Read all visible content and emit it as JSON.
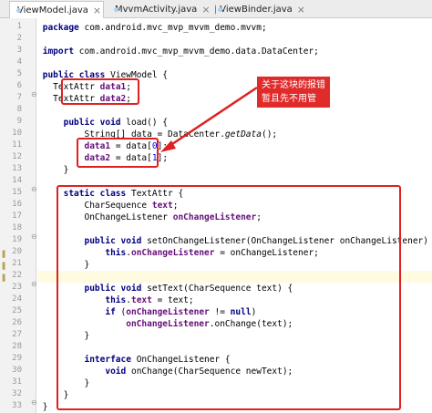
{
  "tabs": [
    {
      "label": "ViewModel.java",
      "close": "×",
      "active": true
    },
    {
      "label": "MvvmActivity.java",
      "close": "×",
      "active": false
    },
    {
      "label": "ViewBinder.java",
      "close": "×",
      "active": false
    }
  ],
  "line_numbers": [
    "1",
    "2",
    "3",
    "4",
    "5",
    "6",
    "7",
    "8",
    "9",
    "10",
    "11",
    "12",
    "13",
    "14",
    "15",
    "16",
    "17",
    "18",
    "19",
    "20",
    "21",
    "22",
    "23",
    "24",
    "25",
    "26",
    "27",
    "28",
    "29",
    "30",
    "31",
    "32",
    "33"
  ],
  "callout": {
    "text": "关于这块的报错暂且先不用管"
  },
  "code": {
    "l1": {
      "kw": "package",
      "rest": " com.android.mvc_mvp_mvvm_demo.mvvm;"
    },
    "l3": {
      "kw": "import",
      "rest": " com.android.mvc_mvp_mvvm_demo.data.DataCenter;"
    },
    "l5": {
      "kw": "public class",
      "rest": " ViewModel {"
    },
    "l6": {
      "type": "TextAttr ",
      "field": "data1",
      "end": ";"
    },
    "l7": {
      "type": "TextAttr ",
      "field": "data2",
      "end": ";"
    },
    "l9": {
      "kw": "public void",
      "rest": " load() {"
    },
    "l10": {
      "pre": "String[] data = DataCenter.",
      "method": "getData",
      "post": "();"
    },
    "l11": {
      "field": "data1",
      "pre": " = data[",
      "num": "0",
      "post": "];"
    },
    "l12": {
      "field": "data2",
      "pre": " = data[",
      "num": "1",
      "post": "];"
    },
    "l13": {
      "text": "}"
    },
    "l15": {
      "kw": "static class",
      "rest": " TextAttr {"
    },
    "l16": {
      "pre": "CharSequence ",
      "field": "text",
      "post": ";"
    },
    "l17": {
      "pre": "OnChangeListener ",
      "field": "onChangeListener",
      "post": ";"
    },
    "l19": {
      "kw": "public void",
      "rest": " setOnChangeListener(OnChangeListener onChangeListener) {"
    },
    "l20": {
      "kw": "this",
      "dot": ".",
      "field": "onChangeListener",
      "post": " = onChangeListener;"
    },
    "l21": {
      "text": "}"
    },
    "l23": {
      "kw": "public void",
      "rest": " setText(CharSequence text) {"
    },
    "l24": {
      "kw": "this",
      "dot": ".",
      "field": "text",
      "post": " = text;"
    },
    "l25": {
      "kw": "if",
      "pre": " (",
      "field": "onChangeListener",
      "kw2": "null",
      "mid": " != ",
      "post": ")"
    },
    "l26": {
      "field": "onChangeListener",
      "post": ".onChange(text);"
    },
    "l27": {
      "text": "}"
    },
    "l29": {
      "kw": "interface",
      "rest": " OnChangeListener {"
    },
    "l30": {
      "kw": "void",
      "rest": " onChange(CharSequence newText);"
    },
    "l31": {
      "text": "}"
    },
    "l32": {
      "text": "}"
    },
    "l33": {
      "text": "}"
    }
  },
  "colors": {
    "keyword": "#000080",
    "field": "#660e7a",
    "number": "#0000ff",
    "annotation_red": "#e02020"
  }
}
